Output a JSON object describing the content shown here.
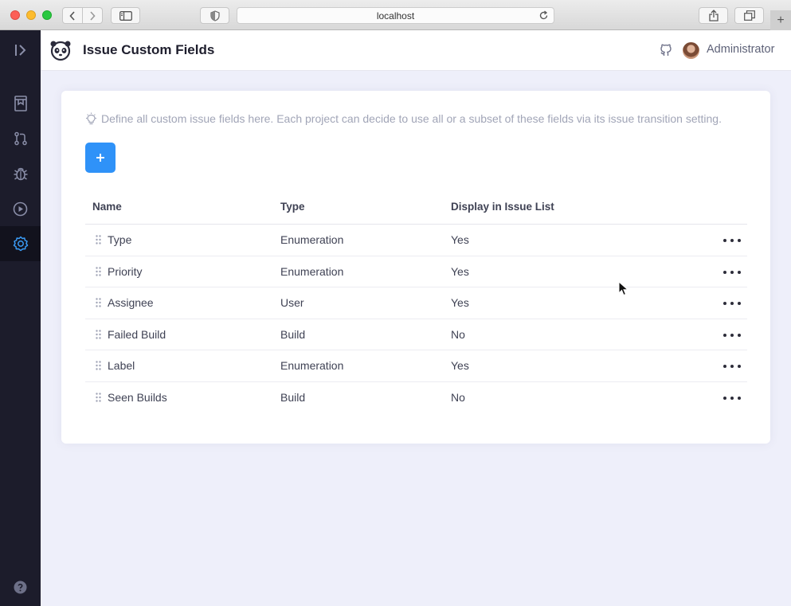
{
  "browser": {
    "url": "localhost",
    "newtab_label": "+"
  },
  "header": {
    "title": "Issue Custom Fields",
    "user_name": "Administrator"
  },
  "tip": "Define all custom issue fields here. Each project can decide to use all or a subset of these fields via its issue transition setting.",
  "add_button_label": "+",
  "table": {
    "columns": [
      "Name",
      "Type",
      "Display in Issue List"
    ],
    "rows": [
      {
        "name": "Type",
        "type": "Enumeration",
        "display": "Yes"
      },
      {
        "name": "Priority",
        "type": "Enumeration",
        "display": "Yes"
      },
      {
        "name": "Assignee",
        "type": "User",
        "display": "Yes"
      },
      {
        "name": "Failed Build",
        "type": "Build",
        "display": "No"
      },
      {
        "name": "Label",
        "type": "Enumeration",
        "display": "Yes"
      },
      {
        "name": "Seen Builds",
        "type": "Build",
        "display": "No"
      }
    ]
  },
  "sidebar": {
    "items": [
      "toggle-icon",
      "builds-icon",
      "pull-request-icon",
      "bug-icon",
      "play-circle-icon",
      "gear-icon",
      "help-icon"
    ],
    "active": "gear-icon"
  },
  "colors": {
    "accent": "#2f92f8",
    "sidebar_bg": "#1c1c2b",
    "main_bg": "#eeeffa"
  }
}
